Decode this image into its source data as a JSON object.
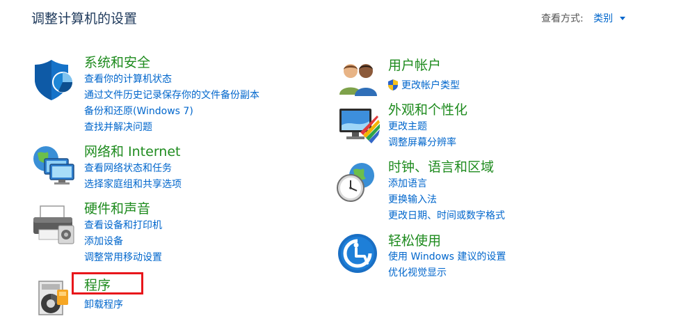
{
  "header": {
    "title": "调整计算机的设置",
    "view_by_label": "查看方式:",
    "view_by_value": "类别"
  },
  "left_column": [
    {
      "title": "系统和安全",
      "icon": "shield-icon",
      "links": [
        "查看你的计算机状态",
        "通过文件历史记录保存你的文件备份副本",
        "备份和还原(Windows 7)",
        "查找并解决问题"
      ]
    },
    {
      "title": "网络和 Internet",
      "icon": "network-globe-icon",
      "links": [
        "查看网络状态和任务",
        "选择家庭组和共享选项"
      ]
    },
    {
      "title": "硬件和声音",
      "icon": "printer-icon",
      "links": [
        "查看设备和打印机",
        "添加设备",
        "调整常用移动设置"
      ]
    },
    {
      "title": "程序",
      "icon": "programs-disc-icon",
      "links": [
        "卸载程序"
      ]
    }
  ],
  "right_column": [
    {
      "title": "用户帐户",
      "icon": "users-icon",
      "links": [
        "更改帐户类型"
      ]
    },
    {
      "title": "外观和个性化",
      "icon": "monitor-palette-icon",
      "links": [
        "更改主题",
        "调整屏幕分辨率"
      ]
    },
    {
      "title": "时钟、语言和区域",
      "icon": "clock-globe-icon",
      "links": [
        "添加语言",
        "更换输入法",
        "更改日期、时间或数字格式"
      ]
    },
    {
      "title": "轻松使用",
      "icon": "ease-of-access-icon",
      "links": [
        "使用 Windows 建议的设置",
        "优化视觉显示"
      ]
    }
  ],
  "colors": {
    "title_text": "#1e395b",
    "category_green": "#1e8b1e",
    "link_blue": "#0066cc",
    "highlight_red": "#e8161b"
  }
}
